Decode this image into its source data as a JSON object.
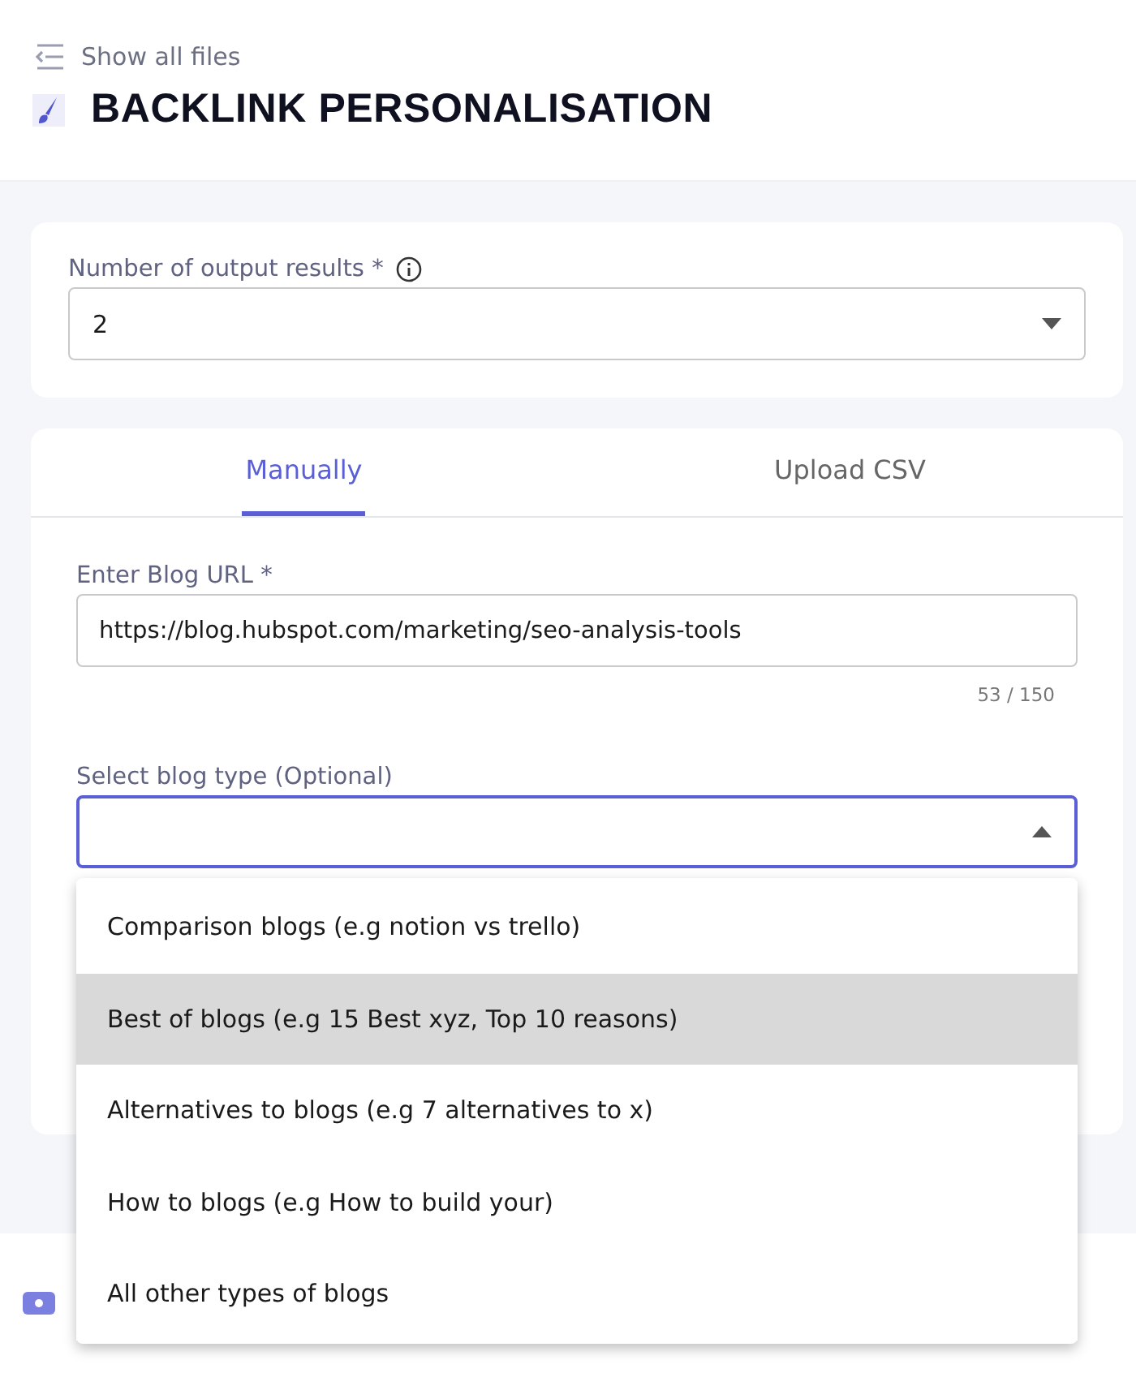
{
  "header": {
    "back_link": "Show all files",
    "title": "BACKLINK PERSONALISATION"
  },
  "output_results": {
    "label": "Number of output results *",
    "value": "2"
  },
  "tabs": [
    {
      "label": "Manually",
      "selected": true
    },
    {
      "label": "Upload CSV",
      "selected": false
    }
  ],
  "blog_url": {
    "label": "Enter Blog URL *",
    "value": "https://blog.hubspot.com/marketing/seo-analysis-tools",
    "counter": "53 / 150"
  },
  "blog_type": {
    "label": "Select blog type (Optional)",
    "expanded": true,
    "options": [
      {
        "label": "Comparison blogs (e.g notion vs trello)",
        "selected": false
      },
      {
        "label": "Best of blogs (e.g 15 Best xyz, Top 10 reasons)",
        "selected": true
      },
      {
        "label": "Alternatives to blogs (e.g 7 alternatives to x)",
        "selected": false
      },
      {
        "label": "How to blogs (e.g How to build your)",
        "selected": false
      },
      {
        "label": "All other types of blogs",
        "selected": false
      }
    ]
  }
}
